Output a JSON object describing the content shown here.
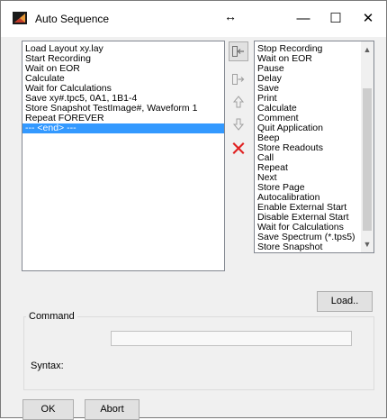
{
  "window": {
    "title": "Auto Sequence",
    "resize_glyph": "↔",
    "minimize": "—",
    "maximize": "☐",
    "close": "✕"
  },
  "sequence_list": {
    "items": [
      "Load Layout xy.lay",
      "Start Recording",
      "Wait on EOR",
      "Calculate",
      "Wait for Calculations",
      "Save xy#.tpc5, 0A1, 1B1-4",
      "Store Snapshot TestImage#, Waveform 1",
      "Repeat FOREVER",
      "--- <end> ---"
    ],
    "selected_index": 8
  },
  "side_buttons": [
    {
      "name": "insert-left-button",
      "icon": "arrow-into-left-icon"
    },
    {
      "name": "insert-right-button",
      "icon": "arrow-into-right-icon"
    },
    {
      "name": "move-up-button",
      "icon": "up-arrow-icon"
    },
    {
      "name": "move-down-button",
      "icon": "down-arrow-icon"
    },
    {
      "name": "delete-button",
      "icon": "red-x-icon"
    }
  ],
  "commands_list": {
    "items": [
      "Stop Recording",
      "Wait on EOR",
      "Pause",
      "Delay",
      "Save",
      "Print",
      "Calculate",
      "Comment",
      "Quit Application",
      "Beep",
      "Store Readouts",
      "Call",
      "Repeat",
      "Next",
      "Store Page",
      "Autocalibration",
      "Enable External Start",
      "Disable External Start",
      "Wait for Calculations",
      "Save Spectrum (*.tps5)",
      "Store Snapshot"
    ]
  },
  "load_button": "Load..",
  "command_group": {
    "label": "Command",
    "value": "",
    "syntax_label": "Syntax:"
  },
  "footer": {
    "ok": "OK",
    "abort": "Abort"
  },
  "colors": {
    "selection": "#3399ff",
    "delete_icon": "#e02020",
    "window_bg": "#f0f0f0"
  }
}
